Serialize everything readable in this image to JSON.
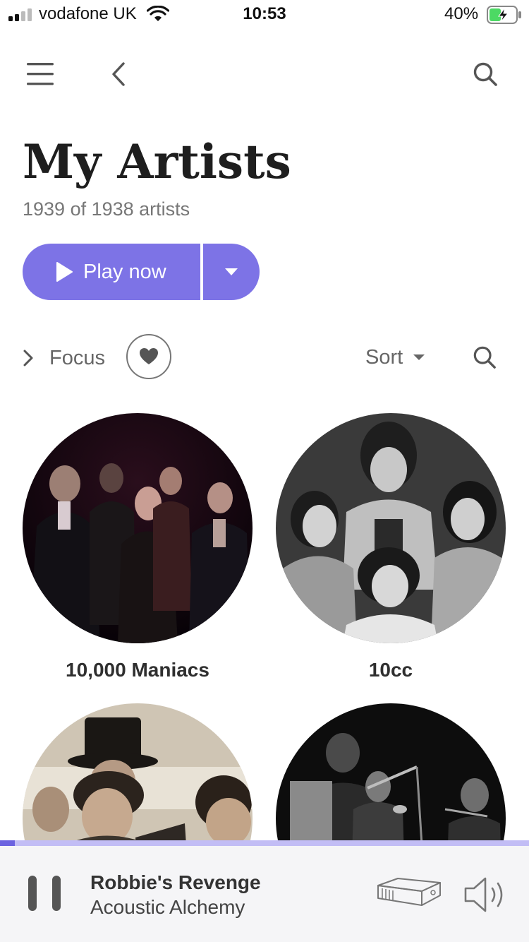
{
  "status_bar": {
    "carrier": "vodafone UK",
    "time": "10:53",
    "battery_percent": "40%",
    "signal_bars": 2,
    "charging": true
  },
  "nav": {
    "menu_icon": "hamburger-menu-icon",
    "back_icon": "chevron-left-icon",
    "search_icon": "search-icon"
  },
  "header": {
    "title": "My Artists",
    "subtitle": "1939 of 1938 artists"
  },
  "actions": {
    "play_label": "Play now",
    "play_icon": "play-icon",
    "dropdown_icon": "caret-down-icon"
  },
  "filters": {
    "focus_label": "Focus",
    "favorites_icon": "heart-icon",
    "sort_label": "Sort",
    "search_icon": "search-icon"
  },
  "artists": [
    {
      "name": "10,000 Maniacs"
    },
    {
      "name": "10cc"
    },
    {
      "name": ""
    },
    {
      "name": ""
    }
  ],
  "now_playing": {
    "title": "Robbie's Revenge",
    "artist": "Acoustic Alchemy",
    "progress": 0.028,
    "pause_icon": "pause-icon",
    "device_icon": "streamer-device-icon",
    "volume_icon": "speaker-volume-icon"
  },
  "colors": {
    "accent": "#7d73e6",
    "progress_fill": "#6c63e0",
    "progress_track": "#c2bdf5",
    "player_background": "#f5f5f7"
  }
}
